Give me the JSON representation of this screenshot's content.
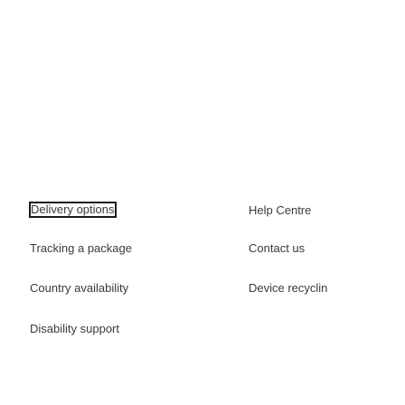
{
  "footer": {
    "left_column": [
      {
        "label": "Delivery options"
      },
      {
        "label": "Tracking a package"
      },
      {
        "label": "Country availability"
      },
      {
        "label": "Disability support"
      }
    ],
    "right_column": [
      {
        "label": "Help Centre"
      },
      {
        "label": "Contact us"
      },
      {
        "label": "Device recyclin"
      }
    ]
  },
  "colors": {
    "background": "#ffffff",
    "link_text": "#3a3a3a",
    "focus_outline": "#1a1a1a"
  }
}
